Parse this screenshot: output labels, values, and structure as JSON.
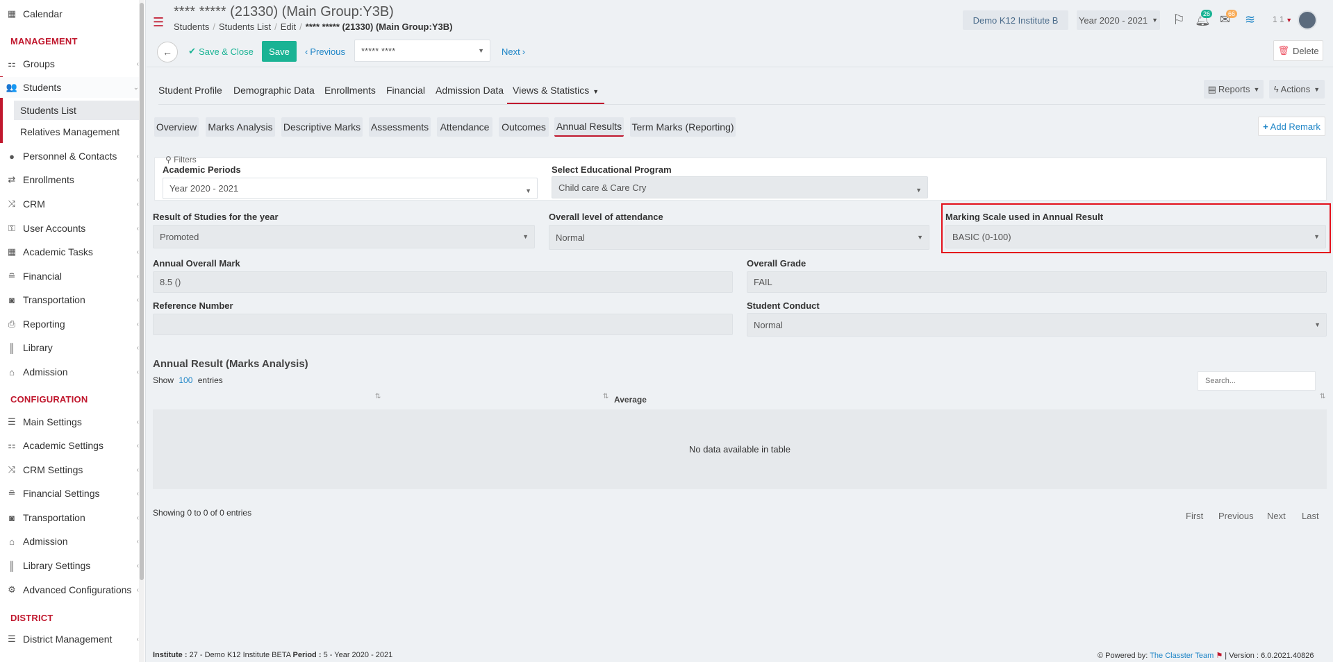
{
  "sidebar": {
    "items": [
      {
        "label": "Calendar",
        "icon": "calendar-icon"
      },
      {
        "label": "Groups",
        "icon": "groups-icon"
      },
      {
        "label": "Students",
        "icon": "students-icon"
      },
      {
        "label": "Personnel & Contacts",
        "icon": "person-icon"
      },
      {
        "label": "Enrollments",
        "icon": "exchange-icon"
      },
      {
        "label": "CRM",
        "icon": "crm-icon"
      },
      {
        "label": "User Accounts",
        "icon": "key-icon"
      },
      {
        "label": "Academic Tasks",
        "icon": "grid-icon"
      },
      {
        "label": "Financial",
        "icon": "coins-icon"
      },
      {
        "label": "Transportation",
        "icon": "bus-icon"
      },
      {
        "label": "Reporting",
        "icon": "print-icon"
      },
      {
        "label": "Library",
        "icon": "books-icon"
      },
      {
        "label": "Admission",
        "icon": "bank-icon"
      }
    ],
    "sub_items": [
      "Students List",
      "Relatives Management"
    ],
    "sections": {
      "management": "MANAGEMENT",
      "configuration": "CONFIGURATION",
      "district": "DISTRICT"
    },
    "config_items": [
      {
        "label": "Main Settings",
        "icon": "sliders-icon"
      },
      {
        "label": "Academic Settings",
        "icon": "groups-icon"
      },
      {
        "label": "CRM Settings",
        "icon": "crm-icon"
      },
      {
        "label": "Financial Settings",
        "icon": "coins-icon"
      },
      {
        "label": "Transportation",
        "icon": "bus-icon"
      },
      {
        "label": "Admission",
        "icon": "bank-icon"
      },
      {
        "label": "Library Settings",
        "icon": "books-icon"
      },
      {
        "label": "Advanced Configurations",
        "icon": "gears-icon"
      }
    ],
    "district_items": [
      {
        "label": "District Management",
        "icon": "list-icon"
      }
    ]
  },
  "header": {
    "title": "**** ***** (21330) (Main Group:Y3B)",
    "breadcrumb": [
      "Students",
      "Students List",
      "Edit"
    ],
    "breadcrumb_current": "**** ***** (21330) (Main Group:Y3B)",
    "institute": "Demo K12 Institute B",
    "year": "Year 2020 - 2021",
    "notifications_count": "26",
    "messages_count": "66",
    "user_short": "1 1"
  },
  "toolbar": {
    "save_close": "Save & Close",
    "save": "Save",
    "previous": "Previous",
    "student_select": "***** ****",
    "next": "Next",
    "delete": "Delete"
  },
  "main_tabs": [
    "Student Profile",
    "Demographic Data",
    "Enrollments",
    "Financial",
    "Admission Data",
    "Views & Statistics"
  ],
  "right_buttons": {
    "reports": "Reports",
    "actions": "Actions"
  },
  "sub_tabs": [
    "Overview",
    "Marks Analysis",
    "Descriptive Marks",
    "Assessments",
    "Attendance",
    "Outcomes",
    "Annual Results",
    "Term Marks (Reporting)"
  ],
  "add_remark": "Add Remark",
  "filters": {
    "title": "Filters",
    "academic_periods_label": "Academic Periods",
    "academic_periods_value": "Year 2020 - 2021",
    "program_label": "Select Educational Program",
    "program_value": "Child care & Care Cry"
  },
  "form": {
    "result_label": "Result of Studies for the year",
    "result_value": "Promoted",
    "attendance_label": "Overall level of attendance",
    "attendance_value": "Normal",
    "scale_label": "Marking Scale used in Annual Result",
    "scale_value": "BASIC (0-100)",
    "annual_mark_label": "Annual Overall Mark",
    "annual_mark_value": "8.5 ()",
    "grade_label": "Overall Grade",
    "grade_value": "FAIL",
    "reference_label": "Reference Number",
    "reference_value": "",
    "conduct_label": "Student Conduct",
    "conduct_value": "Normal"
  },
  "table": {
    "title": "Annual Result (Marks Analysis)",
    "show": "Show",
    "entries_count": "100",
    "entries": "entries",
    "search_placeholder": "Search...",
    "column_average": "Average",
    "empty": "No data available in table",
    "info": "Showing 0 to 0 of 0 entries",
    "pager": [
      "First",
      "Previous",
      "Next",
      "Last"
    ]
  },
  "footer": {
    "institute_label": "Institute :",
    "institute_value": "27 - Demo K12 Institute BETA",
    "period_label": "Period :",
    "period_value": "5 - Year 2020 - 2021",
    "powered_by": "Powered by:",
    "team": "The Classter Team",
    "version": "| Version : 6.0.2021.40826"
  },
  "colors": {
    "brand_red": "#c0172d",
    "save_green": "#1ab394",
    "link_blue": "#1c84c6"
  }
}
